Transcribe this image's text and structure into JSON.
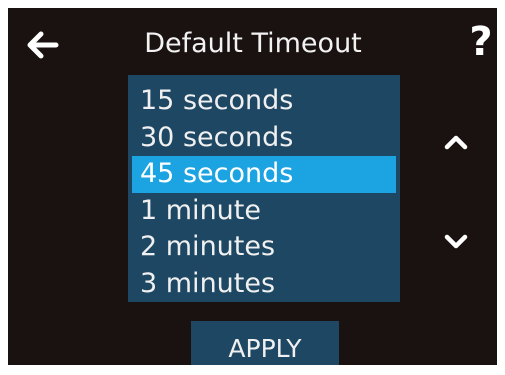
{
  "header": {
    "title": "Default Timeout",
    "back_icon": "arrow-left-icon",
    "help_label": "?"
  },
  "timeout_list": {
    "items": [
      {
        "label": "15 seconds",
        "selected": false
      },
      {
        "label": "30 seconds",
        "selected": false
      },
      {
        "label": "45 seconds",
        "selected": true
      },
      {
        "label": "1 minute",
        "selected": false
      },
      {
        "label": "2 minutes",
        "selected": false
      },
      {
        "label": "3 minutes",
        "selected": false
      }
    ],
    "scroll_up_icon": "chevron-up-icon",
    "scroll_down_icon": "chevron-down-icon"
  },
  "footer": {
    "apply_label": "APPLY"
  },
  "colors": {
    "background": "#1a1210",
    "list_background": "#1d4763",
    "selected": "#1ca3e2",
    "text": "#f0f0f0"
  }
}
